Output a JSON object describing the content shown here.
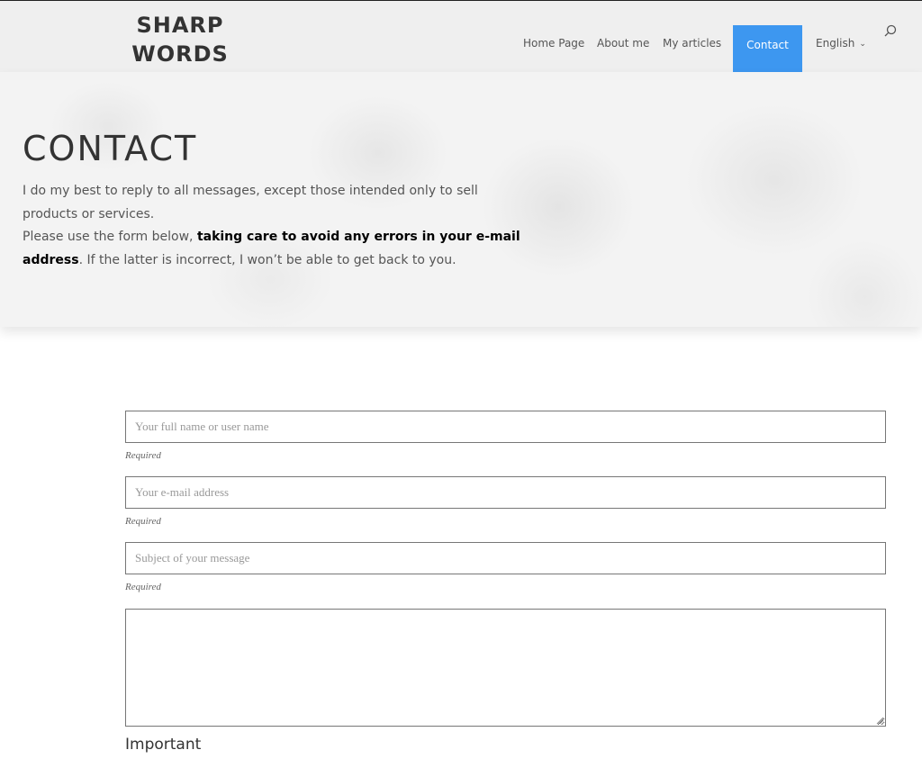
{
  "header": {
    "logo_line1": "SHARP",
    "logo_line2": "WORDS",
    "nav": {
      "home": "Home Page",
      "about": "About me",
      "articles": "My articles",
      "contact": "Contact",
      "language": "English"
    },
    "accent_color": "#3d97f0"
  },
  "hero": {
    "title": "CONTACT",
    "text_line1": "I do my best to reply to all messages, except those intended only to sell products or services.",
    "text_line2_prefix": "Please use the form below, ",
    "text_line2_bold1": "taking care to avoid any errors in your e-mail",
    "text_line2_bold2": "address",
    "text_line2_suffix": ". If the latter is incorrect, I won’t be able to get back to you."
  },
  "form": {
    "name_placeholder": "Your full name or user name",
    "email_placeholder": "Your e-mail address",
    "subject_placeholder": "Subject of your message",
    "required_label": "Required",
    "important_label": "Important"
  },
  "icons": {
    "search": "search-icon",
    "language_chevron": "chevron-down-icon"
  }
}
